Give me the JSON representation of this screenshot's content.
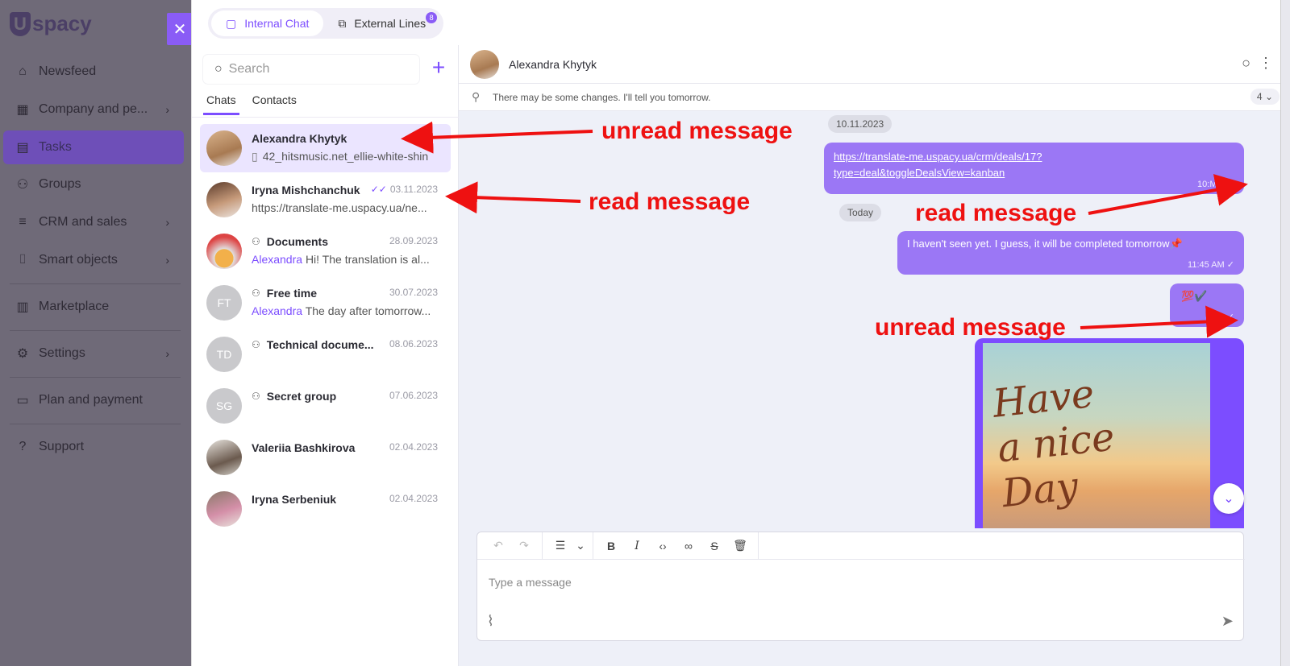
{
  "app": {
    "logo_text": "spacy",
    "logo_letter": "U"
  },
  "sidebar": {
    "close_glyph": "✕",
    "items": [
      {
        "label": "Newsfeed",
        "icon": "home-icon",
        "chevron": false
      },
      {
        "label": "Company and pe...",
        "icon": "building-icon",
        "chevron": true
      },
      {
        "label": "Tasks",
        "icon": "calendar-icon",
        "chevron": false,
        "active": true
      },
      {
        "label": "Groups",
        "icon": "users-icon",
        "chevron": false
      },
      {
        "label": "CRM and sales",
        "icon": "funnel-icon",
        "chevron": true
      },
      {
        "label": "Smart objects",
        "icon": "bracket-icon",
        "chevron": true
      },
      {
        "label": "Marketplace",
        "icon": "store-icon",
        "chevron": false
      },
      {
        "label": "Settings",
        "icon": "gear-icon",
        "chevron": true
      },
      {
        "label": "Plan and payment",
        "icon": "wallet-icon",
        "chevron": false
      },
      {
        "label": "Support",
        "icon": "help-icon",
        "chevron": false
      }
    ]
  },
  "top_tabs": {
    "internal": "Internal Chat",
    "external": "External Lines",
    "external_badge": "8"
  },
  "list": {
    "search_placeholder": "Search",
    "tabs": [
      "Chats",
      "Contacts"
    ],
    "conversations": [
      {
        "name": "Alexandra Khytyk",
        "date": "",
        "status": "sent",
        "preview": "42_hitsmusic.net_ellie-white-shin",
        "preview_prefix": "file",
        "sender": "",
        "avatar": "photo",
        "active": true,
        "group": false
      },
      {
        "name": "Iryna Mishchanchuk",
        "date": "03.11.2023",
        "status": "read",
        "preview": "https://translate-me.uspacy.ua/ne...",
        "sender": "",
        "avatar": "photo",
        "group": false
      },
      {
        "name": "Documents",
        "date": "28.09.2023",
        "preview": "Hi! The translation is al...",
        "sender": "Alexandra",
        "avatar": "photo",
        "group": true
      },
      {
        "name": "Free time",
        "date": "30.07.2023",
        "preview": "The day after tomorrow...",
        "sender": "Alexandra",
        "avatar": "FT",
        "group": true
      },
      {
        "name": "Technical docume...",
        "date": "08.06.2023",
        "preview": "",
        "sender": "",
        "avatar": "TD",
        "group": true
      },
      {
        "name": "Secret group",
        "date": "07.06.2023",
        "preview": "",
        "sender": "",
        "avatar": "SG",
        "group": true
      },
      {
        "name": "Valeriia Bashkirova",
        "date": "02.04.2023",
        "preview": "",
        "sender": "",
        "avatar": "photo",
        "group": false
      },
      {
        "name": "Iryna Serbeniuk",
        "date": "02.04.2023",
        "preview": "",
        "sender": "",
        "avatar": "photo",
        "group": false
      }
    ]
  },
  "chat": {
    "contact_name": "Alexandra Khytyk",
    "pinned_text": "There may be some changes. I'll tell you tomorrow.",
    "pinned_count": "4",
    "date_1": "10.11.2023",
    "date_2": "Today",
    "msg_link_1": "https://translate-me.uspacy.ua/crm/deals/17?",
    "msg_link_2": "type=deal&toggleDealsView=kanban",
    "msg_link_time": "10:",
    "msg_link_time_tail": "M",
    "msg_text": "I haven't seen yet. I guess, it will be completed tomorrow📌",
    "msg_text_time": "11:45 AM",
    "msg_emoji": "💯✔️",
    "msg_emoji_time": "M",
    "image_text_line1": "Have",
    "image_text_line2": "a nice",
    "image_text_line3": "Day",
    "composer_placeholder": "Type a message"
  },
  "annotations": {
    "a1": "unread message",
    "a2": "read message",
    "a3": "read message",
    "a4": "unread message",
    "color": "#ee1111"
  },
  "colors": {
    "accent": "#7c4dff",
    "bubble": "#9b77f5"
  }
}
